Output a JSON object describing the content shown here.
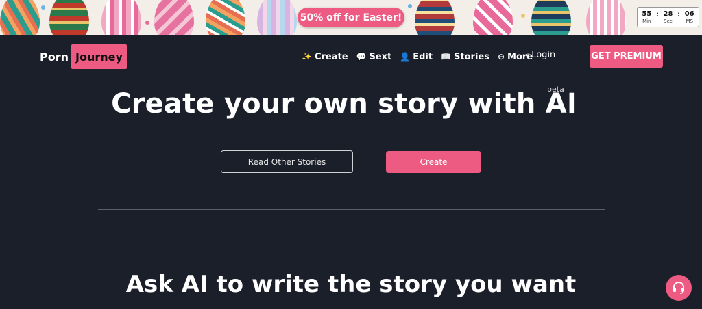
{
  "banner": {
    "promo_text": "50% off for Easter!",
    "countdown": [
      {
        "value": "55",
        "label": "Min"
      },
      {
        "value": "28",
        "label": "Sec"
      },
      {
        "value": "06",
        "label": "MS"
      }
    ],
    "accent_color": "#ee5b82"
  },
  "header": {
    "logo_part1": "Porn",
    "logo_part2": "Journey",
    "nav": [
      {
        "label": "Create",
        "icon": "sparkles-icon"
      },
      {
        "label": "Sext",
        "icon": "chat-bubble-icon"
      },
      {
        "label": "Edit",
        "icon": "person-icon"
      },
      {
        "label": "Stories",
        "icon": "book-icon"
      },
      {
        "label": "More",
        "icon": "more-circle-icon"
      }
    ],
    "login_label": "Login",
    "premium_label": "GET PREMIUM"
  },
  "hero": {
    "title": "Create your own story with AI",
    "badge": "beta",
    "read_button": "Read Other Stories",
    "create_button": "Create"
  },
  "section": {
    "title": "Ask AI to write the story you want"
  },
  "colors": {
    "background": "#1b1f2a",
    "accent": "#ee5b82"
  }
}
